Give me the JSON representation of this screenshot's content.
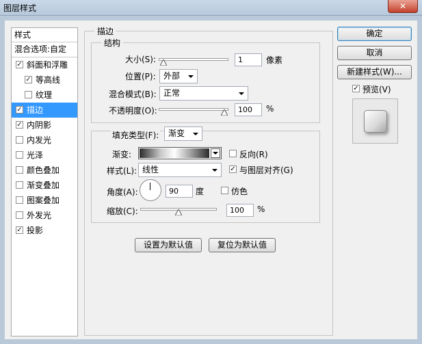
{
  "window": {
    "title": "图层样式",
    "close": "✕"
  },
  "sidebar": {
    "header": "样式",
    "blend_options": "混合选项:自定",
    "items": [
      {
        "label": "斜面和浮雕",
        "checked": true
      },
      {
        "label": "等高线",
        "checked": true,
        "sub": true
      },
      {
        "label": "纹理",
        "checked": false,
        "sub": true
      },
      {
        "label": "描边",
        "checked": true,
        "selected": true
      },
      {
        "label": "内阴影",
        "checked": true
      },
      {
        "label": "内发光",
        "checked": false
      },
      {
        "label": "光泽",
        "checked": false
      },
      {
        "label": "颜色叠加",
        "checked": false
      },
      {
        "label": "渐变叠加",
        "checked": false
      },
      {
        "label": "图案叠加",
        "checked": false
      },
      {
        "label": "外发光",
        "checked": false
      },
      {
        "label": "投影",
        "checked": true
      }
    ]
  },
  "stroke": {
    "title": "描边",
    "structure": {
      "title": "结构",
      "size_label": "大小(S):",
      "size_value": "1",
      "size_unit": "像素",
      "size_fraction": 0.01,
      "position_label": "位置(P):",
      "position_value": "外部",
      "blend_mode_label": "混合模式(B):",
      "blend_mode_value": "正常",
      "opacity_label": "不透明度(O):",
      "opacity_value": "100",
      "opacity_unit": "%",
      "opacity_fraction": 1.0
    },
    "fill": {
      "fill_type_label": "填充类型(F):",
      "fill_type_value": "渐变",
      "gradient_label": "渐变:",
      "reverse_label": "反向(R)",
      "reverse_checked": false,
      "style_label": "样式(L):",
      "style_value": "线性",
      "align_label": "与图层对齐(G)",
      "align_checked": true,
      "angle_label": "角度(A):",
      "angle_value": "90",
      "angle_unit": "度",
      "dither_label": "仿色",
      "dither_checked": false,
      "scale_label": "缩放(C):",
      "scale_value": "100",
      "scale_unit": "%",
      "scale_fraction": 0.5
    },
    "make_default": "设置为默认值",
    "reset_default": "复位为默认值"
  },
  "buttons": {
    "ok": "确定",
    "cancel": "取消",
    "new_style": "新建样式(W)...",
    "preview_label": "预览(V)",
    "preview_checked": true
  },
  "check_glyph": "✓"
}
